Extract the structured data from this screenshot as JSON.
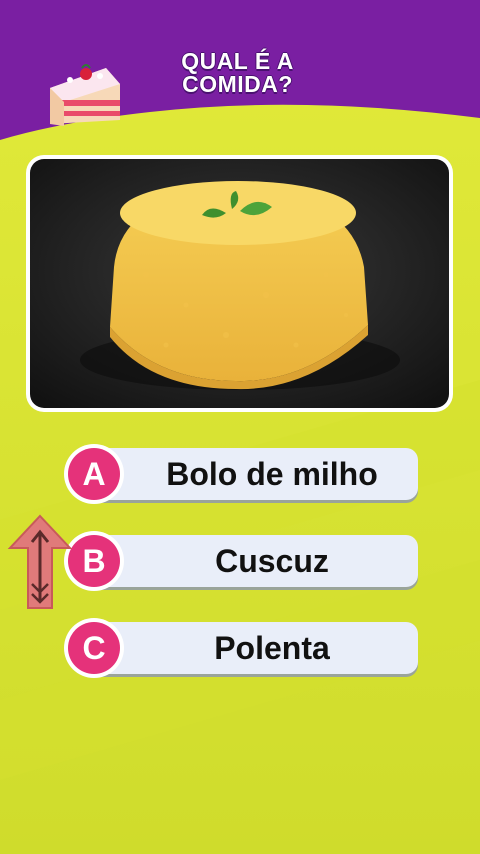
{
  "header": {
    "title": "QUAL É A\nCOMIDA?"
  },
  "icons": {
    "cake": "cake-slice-icon",
    "arrow": "up-arrow-icon"
  },
  "colors": {
    "header_purple": "#7a1fa2",
    "background_yellow": "#dbe632",
    "badge_pink": "#e5327a",
    "option_fill": "#e9eef9"
  },
  "options": [
    {
      "letter": "A",
      "text": "Bolo de milho"
    },
    {
      "letter": "B",
      "text": "Cuscuz"
    },
    {
      "letter": "C",
      "text": "Polenta"
    }
  ]
}
